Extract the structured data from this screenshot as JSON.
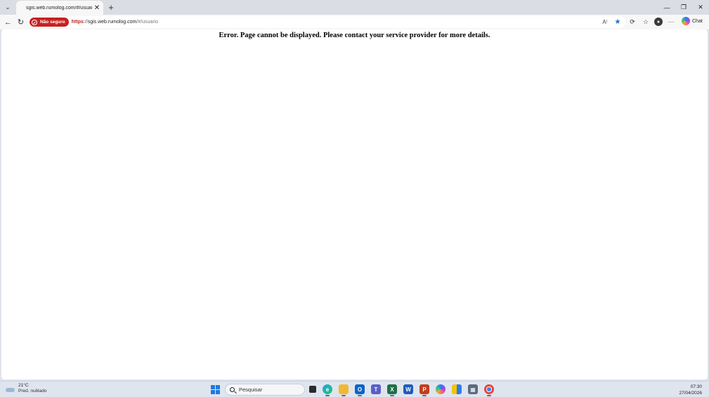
{
  "browser": {
    "tab": {
      "title": "sgis.web.rumolog.com/#/usuario",
      "close_glyph": "✕"
    },
    "tab_list_glyph": "⌄",
    "new_tab_glyph": "+",
    "window_controls": {
      "minimize": "—",
      "restore": "❐",
      "close": "✕"
    },
    "nav": {
      "back": "←",
      "refresh": "↻"
    },
    "address": {
      "security_label": "Não seguro",
      "url_scheme": "https",
      "url_separator": "://",
      "url_host": "sgis.web.rumolog.com",
      "url_path": "/#/usuario"
    },
    "omni_icons": {
      "read_aloud": "A⁾",
      "favorite": "★"
    },
    "toolbar_icons": {
      "extensions": "⟳",
      "favorites": "☆",
      "profile": "●",
      "more": "···"
    },
    "copilot_label": "Chat",
    "colors": {
      "not_secure": "#c5221f",
      "favorite_star": "#1a6fd6"
    }
  },
  "page": {
    "error_message": "Error. Page cannot be displayed. Please contact your service provider for more details."
  },
  "taskbar": {
    "weather": {
      "temperature": "21°C",
      "condition": "Pred. nublado"
    },
    "search_placeholder": "Pesquisar",
    "apps": [
      {
        "name": "task-view-icon",
        "label": "▪"
      },
      {
        "name": "edge-icon",
        "label": "e"
      },
      {
        "name": "file-explorer-icon",
        "label": ""
      },
      {
        "name": "outlook-icon",
        "label": "O"
      },
      {
        "name": "teams-icon",
        "label": "T"
      },
      {
        "name": "excel-icon",
        "label": "X"
      },
      {
        "name": "word-icon",
        "label": "W"
      },
      {
        "name": "powerpoint-icon",
        "label": "P"
      },
      {
        "name": "copilot-app-icon",
        "label": ""
      },
      {
        "name": "file-manager-icon",
        "label": ""
      },
      {
        "name": "calculator-icon",
        "label": "▦"
      },
      {
        "name": "chrome-icon",
        "label": ""
      }
    ],
    "clock": {
      "time": "07:30",
      "date": "27/04/2026"
    }
  }
}
